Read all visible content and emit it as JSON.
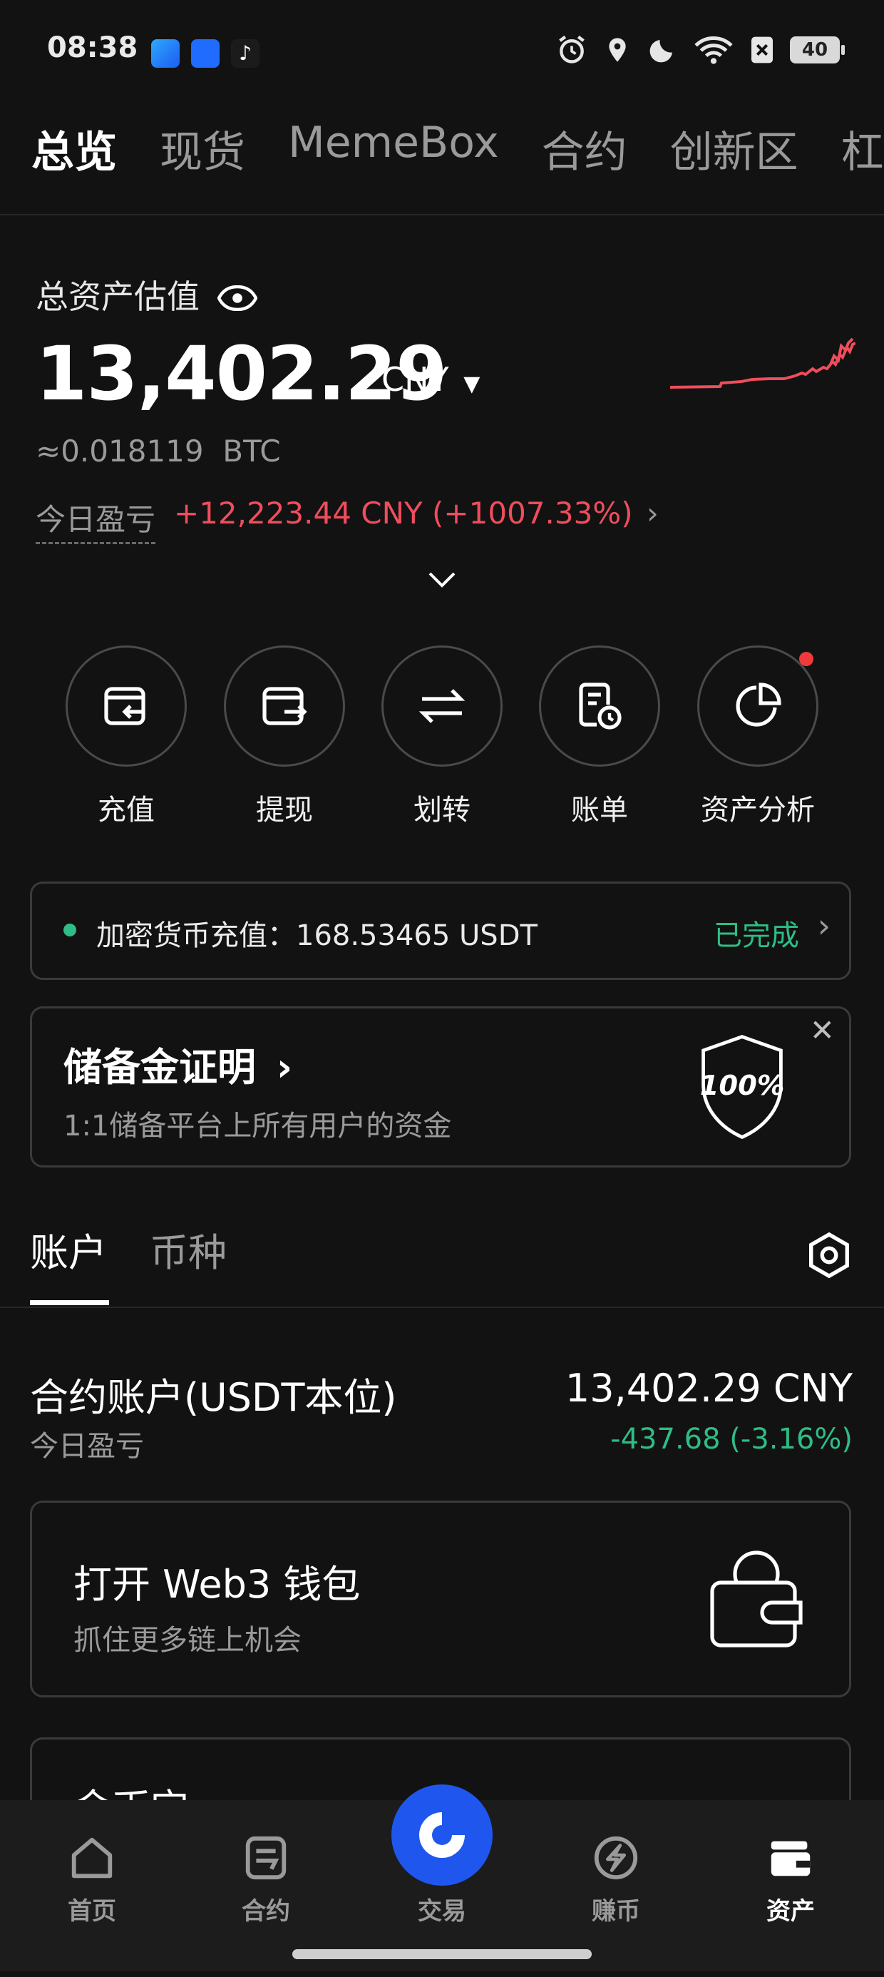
{
  "status_bar": {
    "time": "08:38",
    "battery": "40",
    "icons": [
      "alarm-icon",
      "location-icon",
      "moon-icon",
      "wifi-icon",
      "sim-off-icon",
      "battery-icon"
    ]
  },
  "top_tabs": [
    "总览",
    "现货",
    "MemeBox",
    "合约",
    "创新区",
    "杠杆"
  ],
  "summary": {
    "label": "总资产估值",
    "value": "13,402.29",
    "currency": "CNY",
    "btc_equiv": "≈0.018119  BTC",
    "today_pnl_label": "今日盈亏",
    "today_pnl_value": "+12,223.44 CNY (+1007.33%)"
  },
  "actions": [
    "充值",
    "提现",
    "划转",
    "账单",
    "资产分析"
  ],
  "deposit_notice": {
    "text": "加密货币充值：168.53465 USDT",
    "status": "已完成"
  },
  "reserve": {
    "title": "储备金证明",
    "subtitle": "1:1储备平台上所有用户的资金",
    "badge": "100%"
  },
  "account_tabs": [
    "账户",
    "币种"
  ],
  "futures_account": {
    "name": "合约账户(USDT本位)",
    "sub_label": "今日盈亏",
    "value": "13,402.29 CNY",
    "pnl": "-437.68 (-3.16%)"
  },
  "web3": {
    "title": "打开 Web3 钱包",
    "subtitle": "抓住更多链上机会"
  },
  "earn_card": {
    "title": "金币宝"
  },
  "bottom_nav": [
    "首页",
    "合约",
    "交易",
    "赚币",
    "资产"
  ],
  "colors": {
    "background": "#121212",
    "positive_red": "#ef4d5d",
    "negative_green": "#2ebd85",
    "accent_blue": "#1f57ee"
  }
}
